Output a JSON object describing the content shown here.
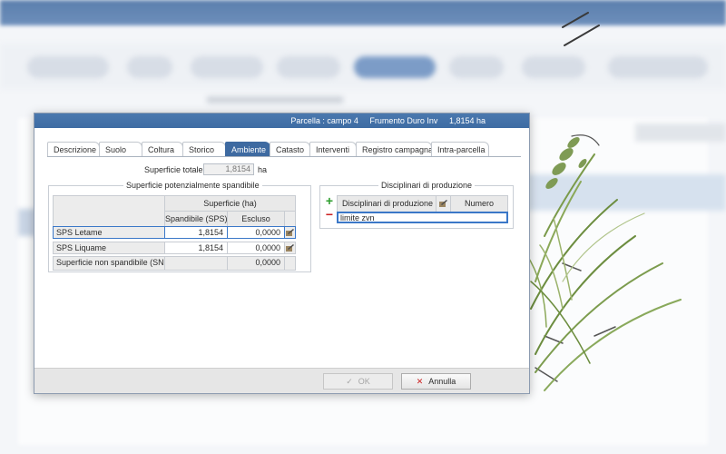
{
  "window": {
    "title_parts": [
      "Parcella : campo 4",
      "Frumento Duro Inv",
      "1,8154 ha"
    ]
  },
  "tabs": [
    "Descrizione",
    "Suolo",
    "Coltura",
    "Storico",
    "Ambiente",
    "Catasto",
    "Interventi",
    "Registro campagna",
    "Intra-parcella"
  ],
  "active_tab": "Ambiente",
  "total_surface": {
    "label": "Superficie totale",
    "value": "1,8154",
    "unit": "ha"
  },
  "spreadable": {
    "title": "Superficie potenzialmente spandibile",
    "group_header": "Superficie (ha)",
    "columns": [
      "Spandibile (SPS)",
      "Escluso"
    ],
    "rows": [
      {
        "label": "SPS Letame",
        "sps": "1,8154",
        "excluded": "0,0000"
      },
      {
        "label": "SPS Liquame",
        "sps": "1,8154",
        "excluded": "0,0000"
      },
      {
        "label": "Superficie non spandibile (SNS)",
        "sps": "",
        "excluded": "0,0000"
      }
    ]
  },
  "disciplinari": {
    "title": "Disciplinari di produzione",
    "columns": [
      "Disciplinari di produzione",
      "Numero"
    ],
    "rows": [
      {
        "name": "limite zvn",
        "number": ""
      }
    ],
    "add_icon": "plus-icon",
    "remove_icon": "minus-icon"
  },
  "buttons": {
    "ok": "OK",
    "cancel": "Annulla"
  },
  "colors": {
    "accent": "#3e6aa1",
    "add": "#2e9e2e",
    "remove": "#cc2222",
    "cancel_icon": "#cc1f1f"
  }
}
